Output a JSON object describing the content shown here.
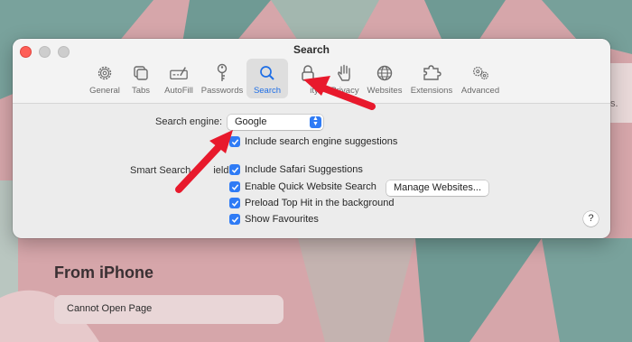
{
  "window": {
    "title": "Search",
    "toolbar": [
      {
        "label": "General",
        "icon": "gear-icon"
      },
      {
        "label": "Tabs",
        "icon": "tabs-icon"
      },
      {
        "label": "AutoFill",
        "icon": "autofill-icon"
      },
      {
        "label": "Passwords",
        "icon": "key-icon"
      },
      {
        "label": "Search",
        "icon": "magnifier-icon",
        "active": true
      },
      {
        "label": "ity",
        "icon": "lock-icon"
      },
      {
        "label": "Privacy",
        "icon": "hand-icon"
      },
      {
        "label": "Websites",
        "icon": "globe-icon"
      },
      {
        "label": "Extensions",
        "icon": "puzzle-icon"
      },
      {
        "label": "Advanced",
        "icon": "gears-icon"
      }
    ]
  },
  "search": {
    "engine_label": "Search engine:",
    "engine_value": "Google",
    "include_suggestions": "Include search engine suggestions",
    "smart_field_label": "Smart Search",
    "smart_field_suffix": "ield:",
    "options": [
      "Include Safari Suggestions",
      "Enable Quick Website Search",
      "Preload Top Hit in the background",
      "Show Favourites"
    ],
    "manage_button": "Manage Websites...",
    "help": "?"
  },
  "background": {
    "heading": "From iPhone",
    "card": "Cannot Open Page",
    "right_snippet": "s."
  },
  "colors": {
    "accent": "#2f7bf5",
    "arrow": "#e8192c",
    "close": "#fe5f57"
  }
}
